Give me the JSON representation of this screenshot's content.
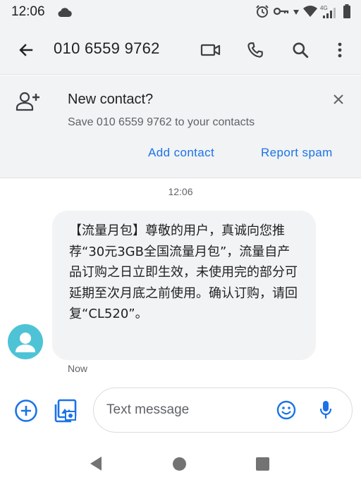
{
  "status_bar": {
    "time": "12:06",
    "network_label": "4G",
    "icons": [
      "cloud-icon",
      "alarm-icon",
      "key-icon",
      "wifi-icon",
      "signal-icon",
      "battery-icon"
    ]
  },
  "app_bar": {
    "title": "010 6559 9762",
    "icons": [
      "back-arrow-icon",
      "video-call-icon",
      "phone-icon",
      "search-icon",
      "more-vert-icon"
    ]
  },
  "banner": {
    "title": "New contact?",
    "subtitle": "Save 010 6559 9762 to your contacts",
    "add_contact_label": "Add contact",
    "report_spam_label": "Report spam",
    "accent_color": "#1a73e8"
  },
  "conversation": {
    "timestamp": "12:06",
    "messages": [
      {
        "text": "【流量月包】尊敬的用户，真诚向您推荐“30元3GB全国流量月包”，流量自产品订购之日立即生效，未使用完的部分可延期至次月底之前使用。确认订购，请回复“CL520”。",
        "status": "Now",
        "avatar_color": "#4ec3d6"
      }
    ]
  },
  "compose": {
    "placeholder": "Text message",
    "icons": [
      "add-circle-icon",
      "media-gallery-icon",
      "emoji-icon",
      "mic-icon"
    ],
    "accent_color": "#1a73e8"
  },
  "nav_bar": {
    "icons": [
      "nav-back-icon",
      "nav-home-icon",
      "nav-recents-icon"
    ]
  }
}
